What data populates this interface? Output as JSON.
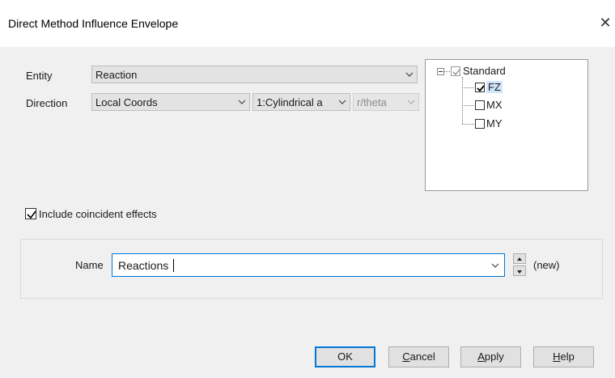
{
  "window": {
    "title": "Direct Method Influence Envelope",
    "close_glyph": "✕"
  },
  "form": {
    "entity_label": "Entity",
    "entity_value": "Reaction",
    "direction_label": "Direction",
    "direction_value": "Local Coords",
    "coord_system_value": "1:Cylindrical a",
    "component_value": "r/theta"
  },
  "tree": {
    "root": {
      "label": "Standard",
      "checked": true
    },
    "children": [
      {
        "label": "FZ",
        "checked": true
      },
      {
        "label": "MX",
        "checked": false
      },
      {
        "label": "MY",
        "checked": false
      }
    ]
  },
  "include_coincident": {
    "label": "Include coincident effects",
    "checked": true
  },
  "name_group": {
    "label": "Name",
    "value": "Reactions",
    "status": "(new)"
  },
  "buttons": {
    "ok": "OK",
    "cancel_mnemonic": "C",
    "cancel_rest": "ancel",
    "apply_mnemonic": "A",
    "apply_rest": "pply",
    "help_mnemonic": "H",
    "help_rest": "elp"
  },
  "colors": {
    "accent": "#0078d7",
    "dialog_bg": "#f0f0f0",
    "titlebar_bg": "#ffffff"
  }
}
